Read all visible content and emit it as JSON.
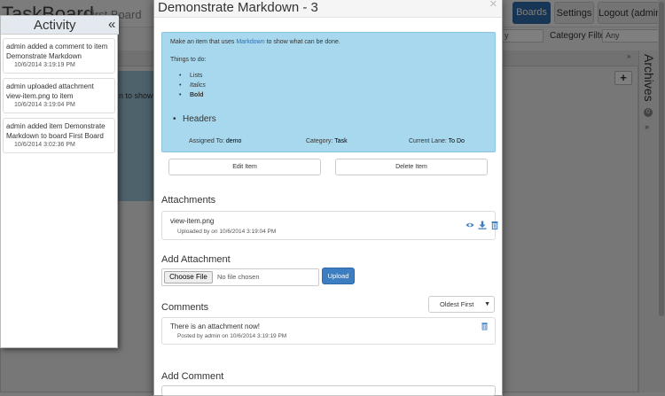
{
  "app": {
    "brand": "TaskBoard",
    "board_name": "First Board",
    "nav": {
      "boards": "Boards",
      "settings": "Settings",
      "logout": "Logout (admin)"
    },
    "filters": {
      "category_label": "Category Filter:",
      "category_value": "Any",
      "first_value": "y"
    },
    "background_card_text": "n to show",
    "archives": {
      "label": "Archives",
      "count": "0"
    },
    "add_button": "+"
  },
  "activity": {
    "title": "Activity",
    "collapse_glyph": "«",
    "items": [
      {
        "text": "admin added a comment to item Demonstrate Markdown",
        "time": "10/6/2014 3:19:19 PM"
      },
      {
        "text": "admin uploaded attachment view-item.png to item",
        "time": "10/6/2014 3:19:04 PM"
      },
      {
        "text": "admin added item Demonstrate Markdown to board First Board",
        "time": "10/6/2014 3:02:36 PM"
      }
    ]
  },
  "modal": {
    "title": "Demonstrate Markdown - 3",
    "close_glyph": "×",
    "description": {
      "intro_before": "Make an item that uses ",
      "intro_link": "Markdown",
      "intro_after": " to show what can be done.",
      "things_label": "Things to do:",
      "list": [
        "Lists",
        "Italics",
        "Bold"
      ],
      "header": "Headers",
      "assigned_label": "Assigned To:",
      "assigned_value": "demo",
      "category_label": "Category:",
      "category_value": "Task",
      "lane_label": "Current Lane:",
      "lane_value": "To Do"
    },
    "edit_button": "Edit Item",
    "delete_button": "Delete Item",
    "attachments": {
      "heading": "Attachments",
      "items": [
        {
          "name": "view-item.png",
          "meta": "Uploaded by on 10/6/2014 3:19:04 PM"
        }
      ]
    },
    "add_attachment": {
      "heading": "Add Attachment",
      "choose_label": "Choose File",
      "no_file": "No file chosen",
      "upload_label": "Upload"
    },
    "comments": {
      "heading": "Comments",
      "sort_value": "Oldest First",
      "items": [
        {
          "text": "There is an attachment now!",
          "meta": "Posted by admin on 10/6/2014 3:19:19 PM"
        }
      ]
    },
    "add_comment": {
      "heading": "Add Comment"
    }
  },
  "colors": {
    "primary": "#3c7ec1",
    "description_bg": "#a8d8ee",
    "link": "#2a6fb1"
  }
}
